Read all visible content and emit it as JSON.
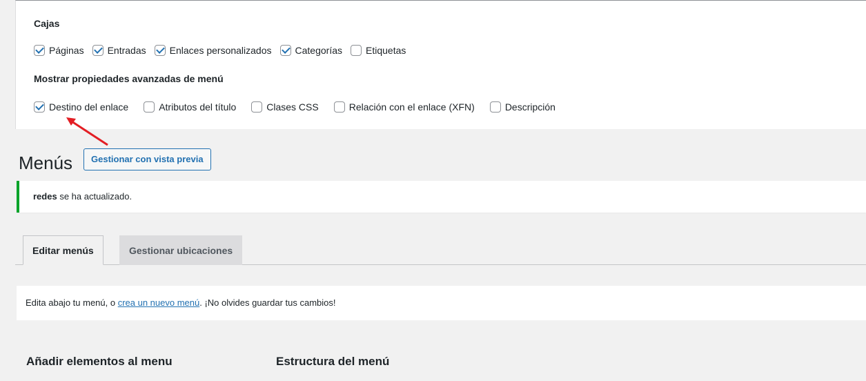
{
  "screen_options": {
    "boxes_heading": "Cajas",
    "boxes": [
      {
        "label": "Páginas",
        "checked": true
      },
      {
        "label": "Entradas",
        "checked": true
      },
      {
        "label": "Enlaces personalizados",
        "checked": true
      },
      {
        "label": "Categorías",
        "checked": true
      },
      {
        "label": "Etiquetas",
        "checked": false
      }
    ],
    "advanced_heading": "Mostrar propiedades avanzadas de menú",
    "advanced": [
      {
        "label": "Destino del enlace",
        "checked": true
      },
      {
        "label": "Atributos del título",
        "checked": false
      },
      {
        "label": "Clases CSS",
        "checked": false
      },
      {
        "label": "Relación con el enlace (XFN)",
        "checked": false
      },
      {
        "label": "Descripción",
        "checked": false
      }
    ]
  },
  "header": {
    "title": "Menús",
    "preview_button": "Gestionar con vista previa"
  },
  "notice": {
    "menu_name": "redes",
    "message": " se ha actualizado."
  },
  "tabs": [
    {
      "label": "Editar menús",
      "active": true
    },
    {
      "label": "Gestionar ubicaciones",
      "active": false
    }
  ],
  "manage": {
    "text_before": "Edita abajo tu menú, o ",
    "link": "crea un nuevo menú",
    "text_after": ". ¡No olvides guardar tus cambios!"
  },
  "sections": {
    "add_items": "Añadir elementos al menu",
    "structure": "Estructura del menú"
  },
  "colors": {
    "accent": "#2271b1",
    "success": "#00a32a",
    "annotation_arrow": "#e31e24"
  }
}
